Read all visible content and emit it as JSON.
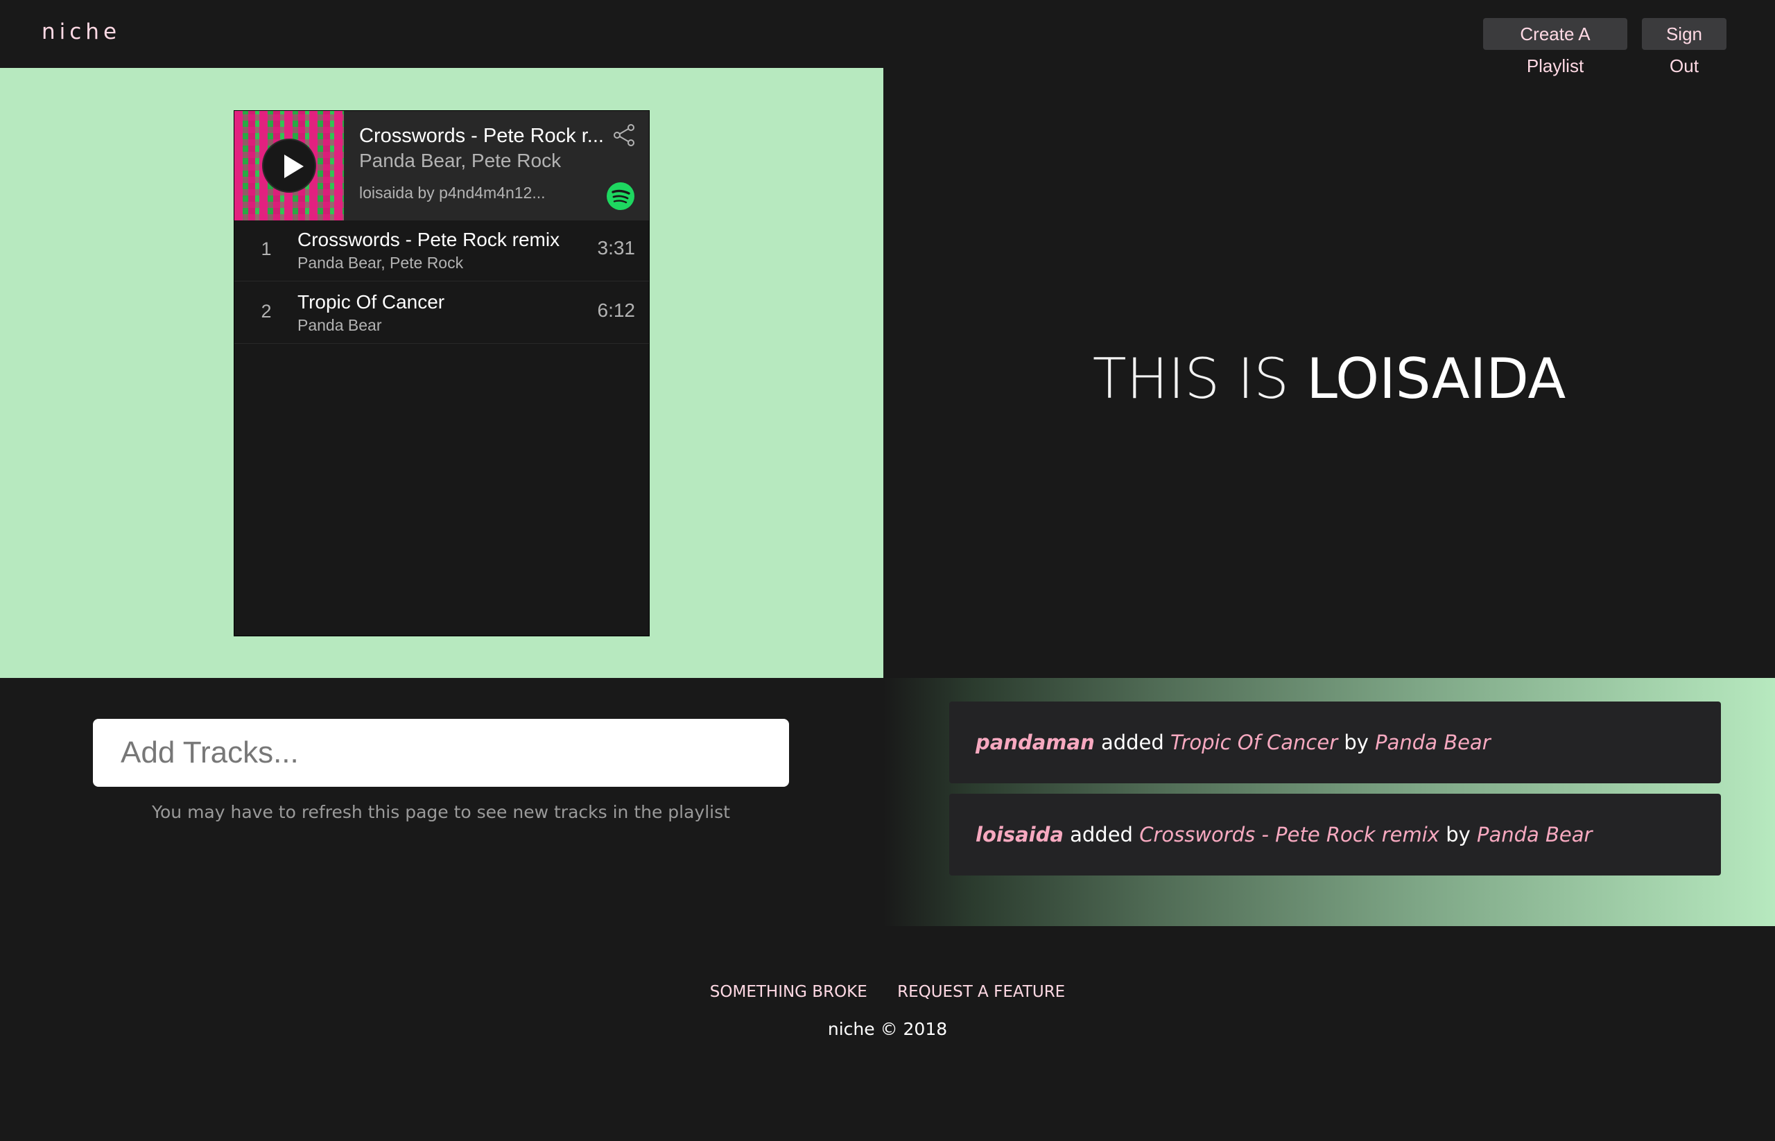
{
  "header": {
    "logo": "niche",
    "create_label": "Create A Playlist",
    "signout_label": "Sign Out"
  },
  "player": {
    "now_playing": {
      "title": "Crosswords - Pete Rock r...",
      "artist": "Panda Bear, Pete Rock",
      "meta": "loisaida by p4nd4m4n12..."
    },
    "tracks": [
      {
        "num": "1",
        "title": "Crosswords - Pete Rock remix",
        "artist": "Panda Bear, Pete Rock",
        "duration": "3:31"
      },
      {
        "num": "2",
        "title": "Tropic Of Cancer",
        "artist": "Panda Bear",
        "duration": "6:12"
      }
    ]
  },
  "playlist_title": {
    "prefix": "THIS IS",
    "name": "LOISAIDA"
  },
  "add_tracks": {
    "placeholder": "Add Tracks...",
    "note": "You may have to refresh this page to see new tracks in the playlist"
  },
  "feed": [
    {
      "user": "pandaman",
      "verb": "added",
      "song": "Tropic Of Cancer",
      "by": "by",
      "artist": "Panda Bear"
    },
    {
      "user": "loisaida",
      "verb": "added",
      "song": "Crosswords - Pete Rock remix",
      "by": "by",
      "artist": "Panda Bear"
    }
  ],
  "footer": {
    "link_broke": "SOMETHING BROKE",
    "link_feature": "REQUEST A FEATURE",
    "copyright": "niche © 2018"
  },
  "colors": {
    "background": "#191919",
    "mint": "#b7e9bf",
    "pink": "#f7a9c0",
    "spotify_green": "#1ed760"
  }
}
